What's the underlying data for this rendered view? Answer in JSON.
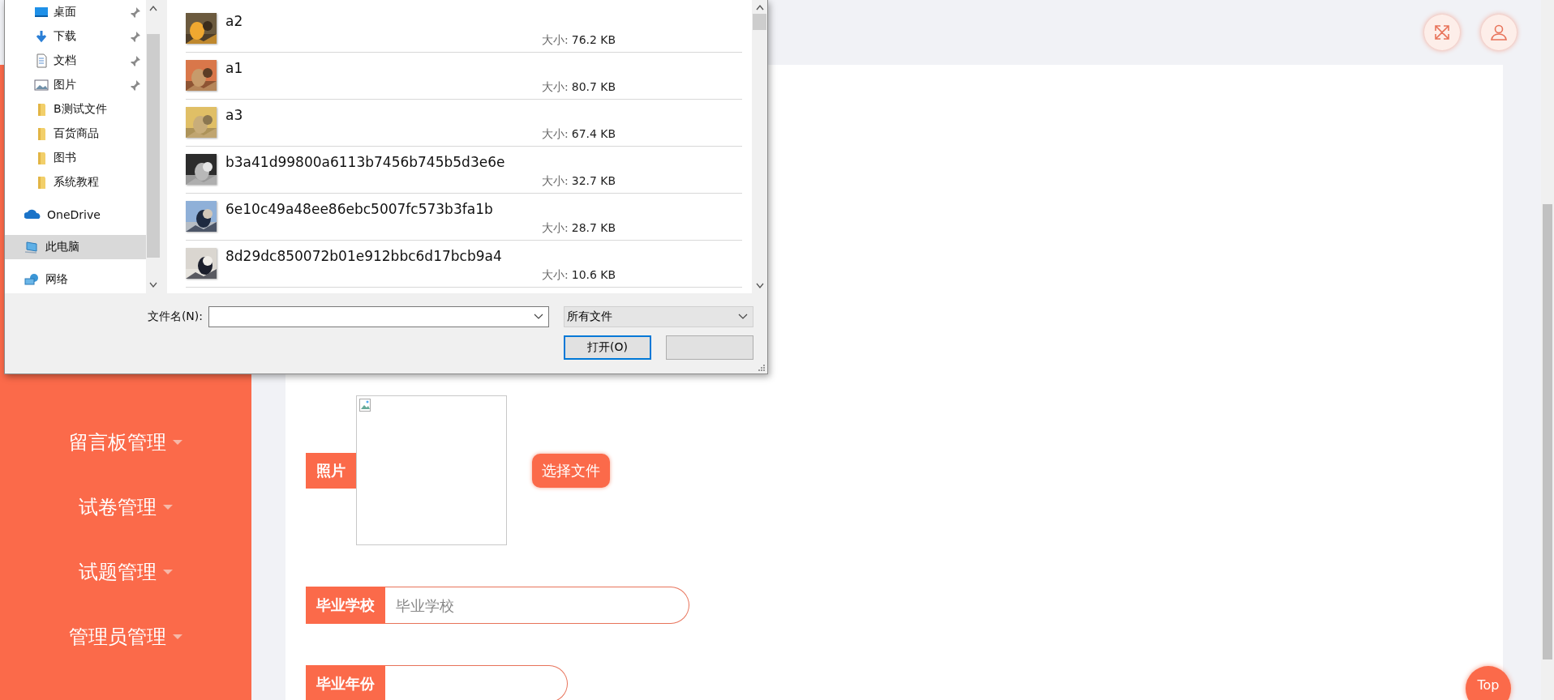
{
  "sidebar": {
    "items": [
      {
        "label": "留言板管理"
      },
      {
        "label": "试卷管理"
      },
      {
        "label": "试题管理"
      },
      {
        "label": "管理员管理"
      }
    ]
  },
  "form": {
    "photo": {
      "label": "照片",
      "button": "选择文件"
    },
    "fields": [
      {
        "label": "毕业学校",
        "placeholder": "毕业学校"
      },
      {
        "label": "毕业年份"
      }
    ]
  },
  "back_to_top": "Top",
  "file_dialog": {
    "nav": [
      {
        "label": "桌面",
        "kind": "quick",
        "pinned": true,
        "selected": false
      },
      {
        "label": "下载",
        "kind": "quick",
        "pinned": true,
        "selected": false
      },
      {
        "label": "文档",
        "kind": "quick",
        "pinned": true,
        "selected": false
      },
      {
        "label": "图片",
        "kind": "quick",
        "pinned": true,
        "selected": false
      },
      {
        "label": "B测试文件",
        "kind": "folder",
        "pinned": false,
        "selected": false
      },
      {
        "label": "百货商品",
        "kind": "folder",
        "pinned": false,
        "selected": false
      },
      {
        "label": "图书",
        "kind": "folder",
        "pinned": false,
        "selected": false
      },
      {
        "label": "系统教程",
        "kind": "folder",
        "pinned": false,
        "selected": false
      },
      {
        "label": "OneDrive",
        "kind": "cloud",
        "pinned": false,
        "selected": false
      },
      {
        "label": "此电脑",
        "kind": "computer",
        "pinned": false,
        "selected": true
      },
      {
        "label": "网络",
        "kind": "network",
        "pinned": false,
        "selected": false
      }
    ],
    "files": [
      {
        "name": "a2",
        "size_label": "大小:",
        "size": "76.2 KB"
      },
      {
        "name": "a1",
        "size_label": "大小:",
        "size": "80.7 KB"
      },
      {
        "name": "a3",
        "size_label": "大小:",
        "size": "67.4 KB"
      },
      {
        "name": "b3a41d99800a6113b7456b745b5d3e6e",
        "size_label": "大小:",
        "size": "32.7 KB"
      },
      {
        "name": "6e10c49a48ee86ebc5007fc573b3fa1b",
        "size_label": "大小:",
        "size": "28.7 KB"
      },
      {
        "name": "8d29dc850072b01e912bbc6d17bcb9a4",
        "size_label": "大小:",
        "size": "10.6 KB"
      }
    ],
    "filename_label": "文件名(N):",
    "file_type": "所有文件",
    "open_button": "打开(O)"
  }
}
